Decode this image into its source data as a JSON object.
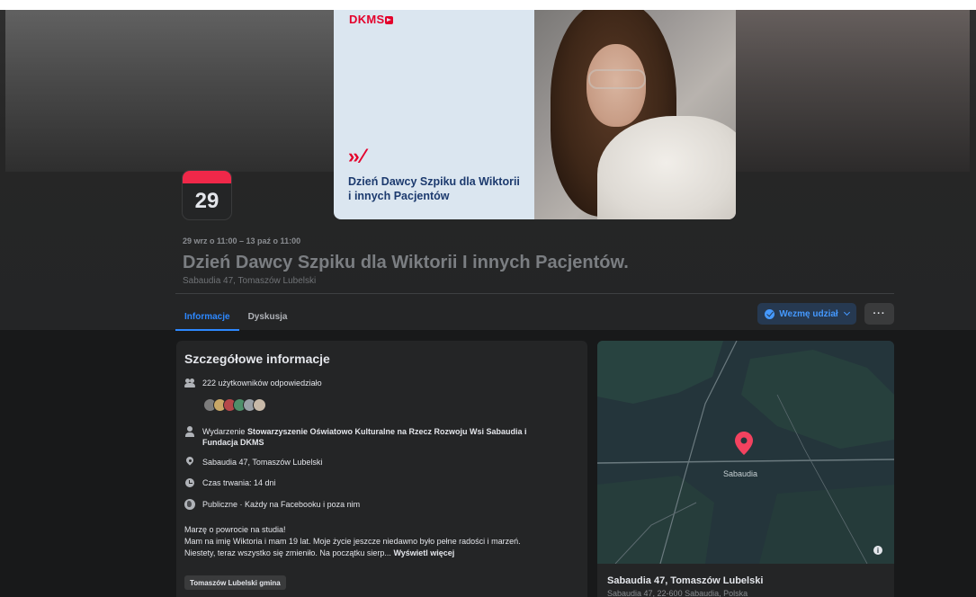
{
  "cover": {
    "logo": "DKMS",
    "arrows": "›› ⁄",
    "title": "Dzień Dawcy Szpiku dla Wiktorii i innych Pacjentów"
  },
  "event": {
    "day": "29",
    "when": "29 wrz o 11:00 – 13 paź o 11:00",
    "title": "Dzień Dawcy Szpiku dla Wiktorii I innych Pacjentów.",
    "location": "Sabaudia 47, Tomaszów Lubelski"
  },
  "tabs": [
    {
      "label": "Informacje",
      "active": true
    },
    {
      "label": "Dyskusja",
      "active": false
    }
  ],
  "actions": {
    "going_label": "Wezmę udział",
    "more_label": "···"
  },
  "details": {
    "title": "Szczegółowe informacje",
    "responded": "222 użytkowników odpowiedziało",
    "organizer_prefix": "Wydarzenie ",
    "organizer_line1": "Stowarzyszenie Oświatowo Kulturalne na Rzecz Rozwoju Wsi Sabaudia i",
    "organizer_line2": "Fundacja DKMS",
    "address": "Sabaudia 47, Tomaszów Lubelski",
    "duration": "Czas trwania: 14 dni",
    "privacy": "Publiczne · Każdy na Facebooku i poza nim",
    "desc_line1": "Marzę o powrocie na studia!",
    "desc_line2": "Mam na imię Wiktoria i mam 19 lat. Moje życie jeszcze niedawno było pełne radości i marzeń.",
    "desc_line3": "Niestety, teraz wszystko się zmieniło. Na początku sierp...",
    "see_more": "Wyświetl więcej",
    "tag": "Tomaszów Lubelski gmina",
    "avatar_colors": [
      "#7c7c7c",
      "#c9a867",
      "#b5484a",
      "#4f8f6a",
      "#9aa0a6",
      "#c8b9a8"
    ]
  },
  "map": {
    "label": "Sabaudia",
    "place": "Sabaudia 47, Tomaszów Lubelski",
    "address": "Sabaudia 47, 22-600 Sabaudia, Polska",
    "info": "i"
  }
}
